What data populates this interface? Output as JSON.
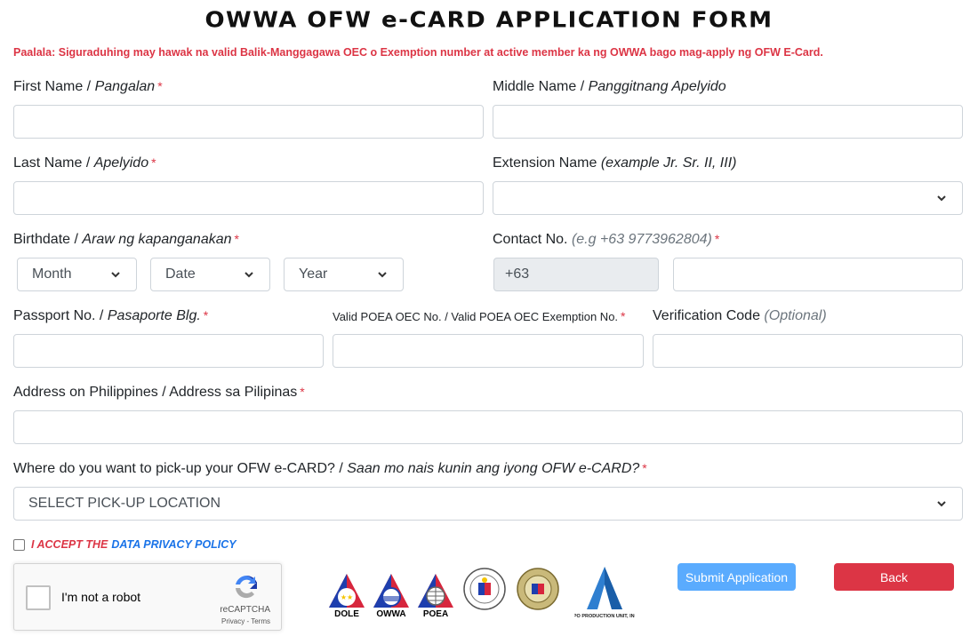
{
  "page": {
    "title": "OWWA OFW e-CARD APPLICATION FORM",
    "notice": "Paalala: Siguraduhing may hawak na valid Balik-Manggagawa OEC o Exemption number at active member ka ng OWWA bago mag-apply ng OFW E-Card."
  },
  "fields": {
    "first_name": {
      "label": "First Name /",
      "label_tl": "Pangalan",
      "required": "*",
      "value": ""
    },
    "middle_name": {
      "label": "Middle Name /",
      "label_tl": "Panggitnang Apelyido",
      "value": ""
    },
    "last_name": {
      "label": "Last Name /",
      "label_tl": "Apelyido",
      "required": "*",
      "value": ""
    },
    "extension_name": {
      "label": "Extension Name",
      "hint": "(example Jr. Sr. II, III)",
      "selected": ""
    },
    "birthdate": {
      "label": "Birthdate /",
      "label_tl": "Araw ng kapanganakan",
      "required": "*",
      "month": "Month",
      "date": "Date",
      "year": "Year"
    },
    "contact": {
      "label": "Contact No.",
      "hint": "(e.g +63 9773962804)",
      "required": "*",
      "prefix": "+63",
      "value": ""
    },
    "passport": {
      "label": "Passport No. /",
      "label_tl": "Pasaporte Blg.",
      "required": "*",
      "value": ""
    },
    "oec": {
      "label": "Valid POEA OEC No. / Valid POEA OEC Exemption No.",
      "required": "*",
      "value": ""
    },
    "verification": {
      "label": "Verification Code",
      "hint": "(Optional)",
      "value": ""
    },
    "address": {
      "label": "Address on Philippines / Address sa Pilipinas",
      "required": "*",
      "value": ""
    },
    "pickup": {
      "label": "Where do you want to pick-up your OFW e-CARD? /",
      "label_tl": "Saan mo nais kunin ang iyong OFW e-CARD?",
      "required": "*",
      "selected": "SELECT PICK-UP LOCATION"
    }
  },
  "consent": {
    "accept": "I ACCEPT THE",
    "policy": "DATA PRIVACY POLICY",
    "checked": false
  },
  "recaptcha": {
    "label": "I'm not a robot",
    "brand": "reCAPTCHA",
    "links": "Privacy - Terms",
    "checked": false
  },
  "logos": [
    {
      "name": "DOLE",
      "caption": "DOLE"
    },
    {
      "name": "OWWA",
      "caption": "OWWA"
    },
    {
      "name": "POEA",
      "caption": "POEA"
    },
    {
      "name": "DFA",
      "caption": ""
    },
    {
      "name": "Bureau of Immigration",
      "caption": ""
    },
    {
      "name": "APO Production Unit",
      "caption": "APO PRODUCTION UNIT, INC."
    }
  ],
  "buttons": {
    "submit": "Submit Application",
    "back": "Back"
  },
  "colors": {
    "required": "#dc3545",
    "link": "#1a73e8",
    "submit": "#5aabfe",
    "back": "#dc3545"
  }
}
